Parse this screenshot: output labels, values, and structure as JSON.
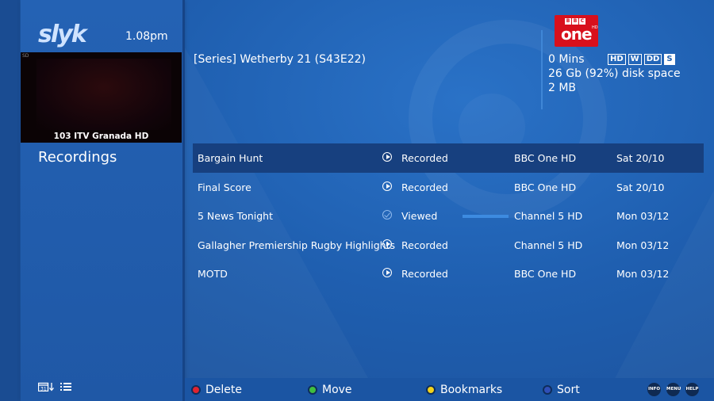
{
  "app": {
    "logo_text": "slyk",
    "clock": "1.08pm"
  },
  "preview": {
    "caption": "103  ITV Granada HD",
    "corner_tag": "SD"
  },
  "sidebar": {
    "section_title": "Recordings"
  },
  "details": {
    "series_title": "[Series] Wetherby 21 (S43E22)",
    "duration": "0 Mins",
    "disk_space": "26 Gb (92%) disk space",
    "size": "2 MB",
    "badges": [
      "HD",
      "W",
      "DD",
      "S"
    ],
    "channel_logo": {
      "top": "BBC",
      "main": "one",
      "suffix": "HD"
    }
  },
  "recordings": [
    {
      "title": "Bargain Hunt",
      "status": "Recorded",
      "status_icon": "play-icon",
      "channel": "BBC One HD",
      "date": "Sat 20/10",
      "selected": true
    },
    {
      "title": "Final Score",
      "status": "Recorded",
      "status_icon": "play-icon",
      "channel": "BBC One HD",
      "date": "Sat 20/10",
      "selected": false
    },
    {
      "title": "5 News Tonight",
      "status": "Viewed",
      "status_icon": "check-icon",
      "channel": "Channel 5 HD",
      "date": "Mon 03/12",
      "selected": false,
      "progress": 1.0
    },
    {
      "title": "Gallagher Premiership Rugby Highlights",
      "status": "Recorded",
      "status_icon": "play-icon",
      "channel": "Channel 5 HD",
      "date": "Mon 03/12",
      "selected": false
    },
    {
      "title": "MOTD",
      "status": "Recorded",
      "status_icon": "play-icon",
      "channel": "BBC One HD",
      "date": "Mon 03/12",
      "selected": false
    }
  ],
  "footer": {
    "delete_label": "Delete",
    "move_label": "Move",
    "bookmarks_label": "Bookmarks",
    "sort_label": "Sort",
    "info_label": "INFO",
    "menu_label": "MENU",
    "help_label": "HELP"
  },
  "colors": {
    "background": "#1f5fb0",
    "selected_row": "#17407f",
    "red_key": "#e0242f",
    "green_key": "#3fbf3f",
    "yellow_key": "#f2d21b",
    "blue_key": "#2f4fb8",
    "progress": "#3d8be0",
    "channel_logo": "#d8101c"
  }
}
